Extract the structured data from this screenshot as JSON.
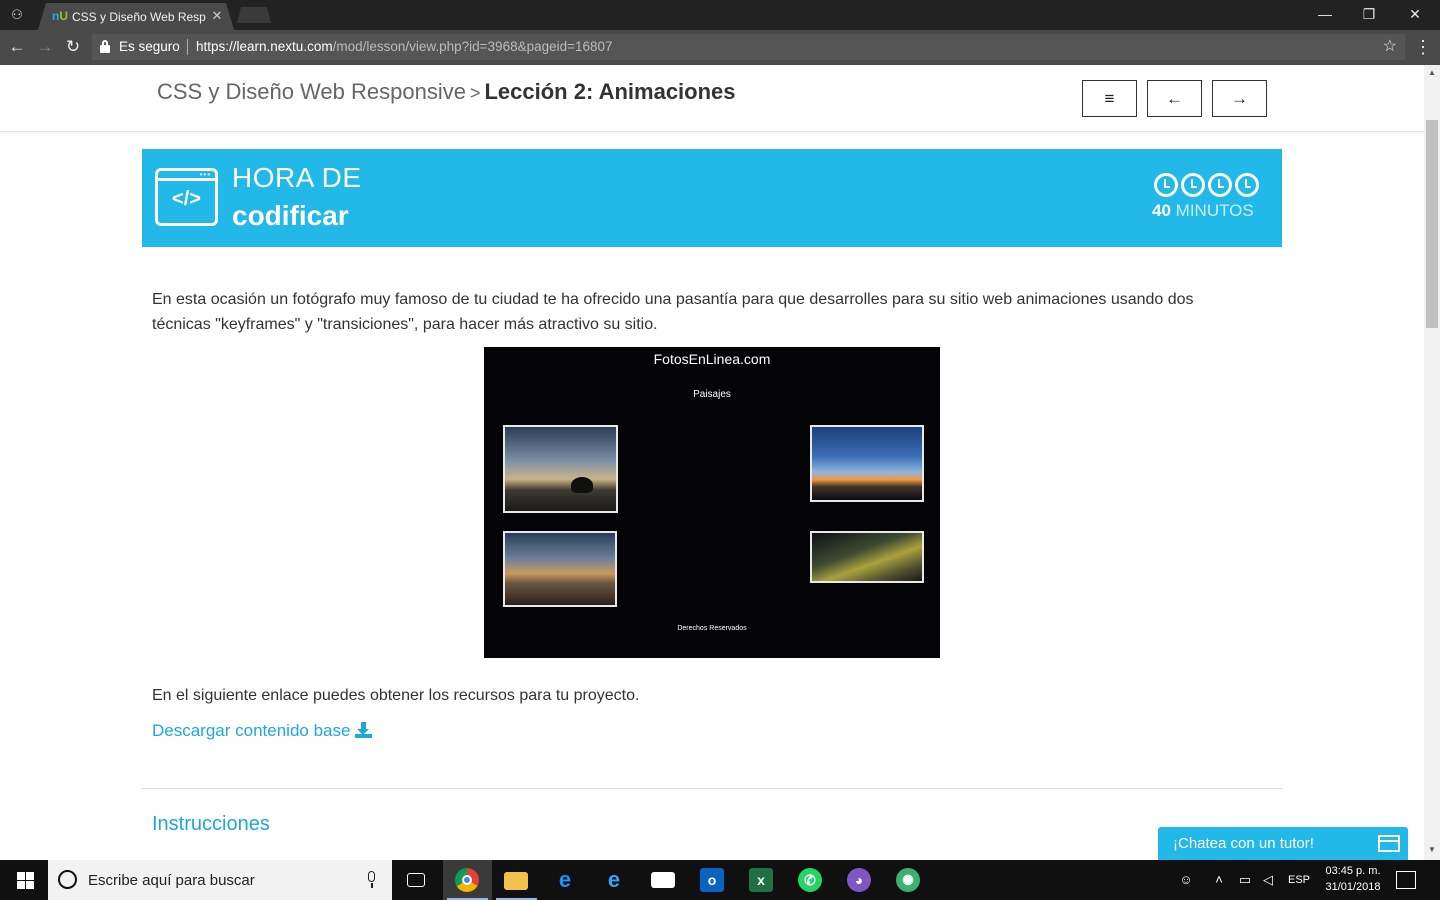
{
  "browser": {
    "tab": {
      "title": "CSS y Diseño Web Responsive",
      "favicon_text": "U"
    },
    "window_controls": {
      "minimize": "—",
      "maximize": "❐",
      "close": "✕"
    },
    "nav": {
      "back": "←",
      "forward": "→",
      "reload": "↻"
    },
    "omnibox": {
      "secure_label": "Es seguro",
      "url_host": "https://learn.nextu.com",
      "url_path": "/mod/lesson/view.php?id=3968&pageid=16807",
      "star": "☆"
    },
    "menu": "⋮"
  },
  "header": {
    "course": "CSS y Diseño Web Responsive",
    "separator": ">",
    "lesson": "Lección 2: Animaciones",
    "buttons": {
      "menu": "≡",
      "prev": "←",
      "next": "→"
    }
  },
  "banner": {
    "line1": "HORA DE",
    "line2": "codificar",
    "icon_text": "</>",
    "minutes_value": "40",
    "minutes_label": "MINUTOS",
    "color": "#22b8e8"
  },
  "content": {
    "intro": "En esta ocasión un fotógrafo muy famoso de tu ciudad te ha ofrecido una pasantía para que desarrolles para su sitio web animaciones usando dos técnicas \"keyframes\" y \"transiciones\", para hacer más atractivo su sitio.",
    "preview": {
      "site_title": "FotosEnLinea.com",
      "subtitle": "Paisajes",
      "footer": "Derechos Reservados"
    },
    "resources_text": "En el siguiente enlace puedes obtener los recursos para tu proyecto.",
    "download_link": "Descargar contenido base",
    "instructions_heading": "Instrucciones"
  },
  "chat": {
    "label": "¡Chatea con un tutor!"
  },
  "taskbar": {
    "search_placeholder": "Escribe aquí para buscar",
    "language": "ESP",
    "time": "03:45 p. m.",
    "date": "31/01/2018"
  }
}
